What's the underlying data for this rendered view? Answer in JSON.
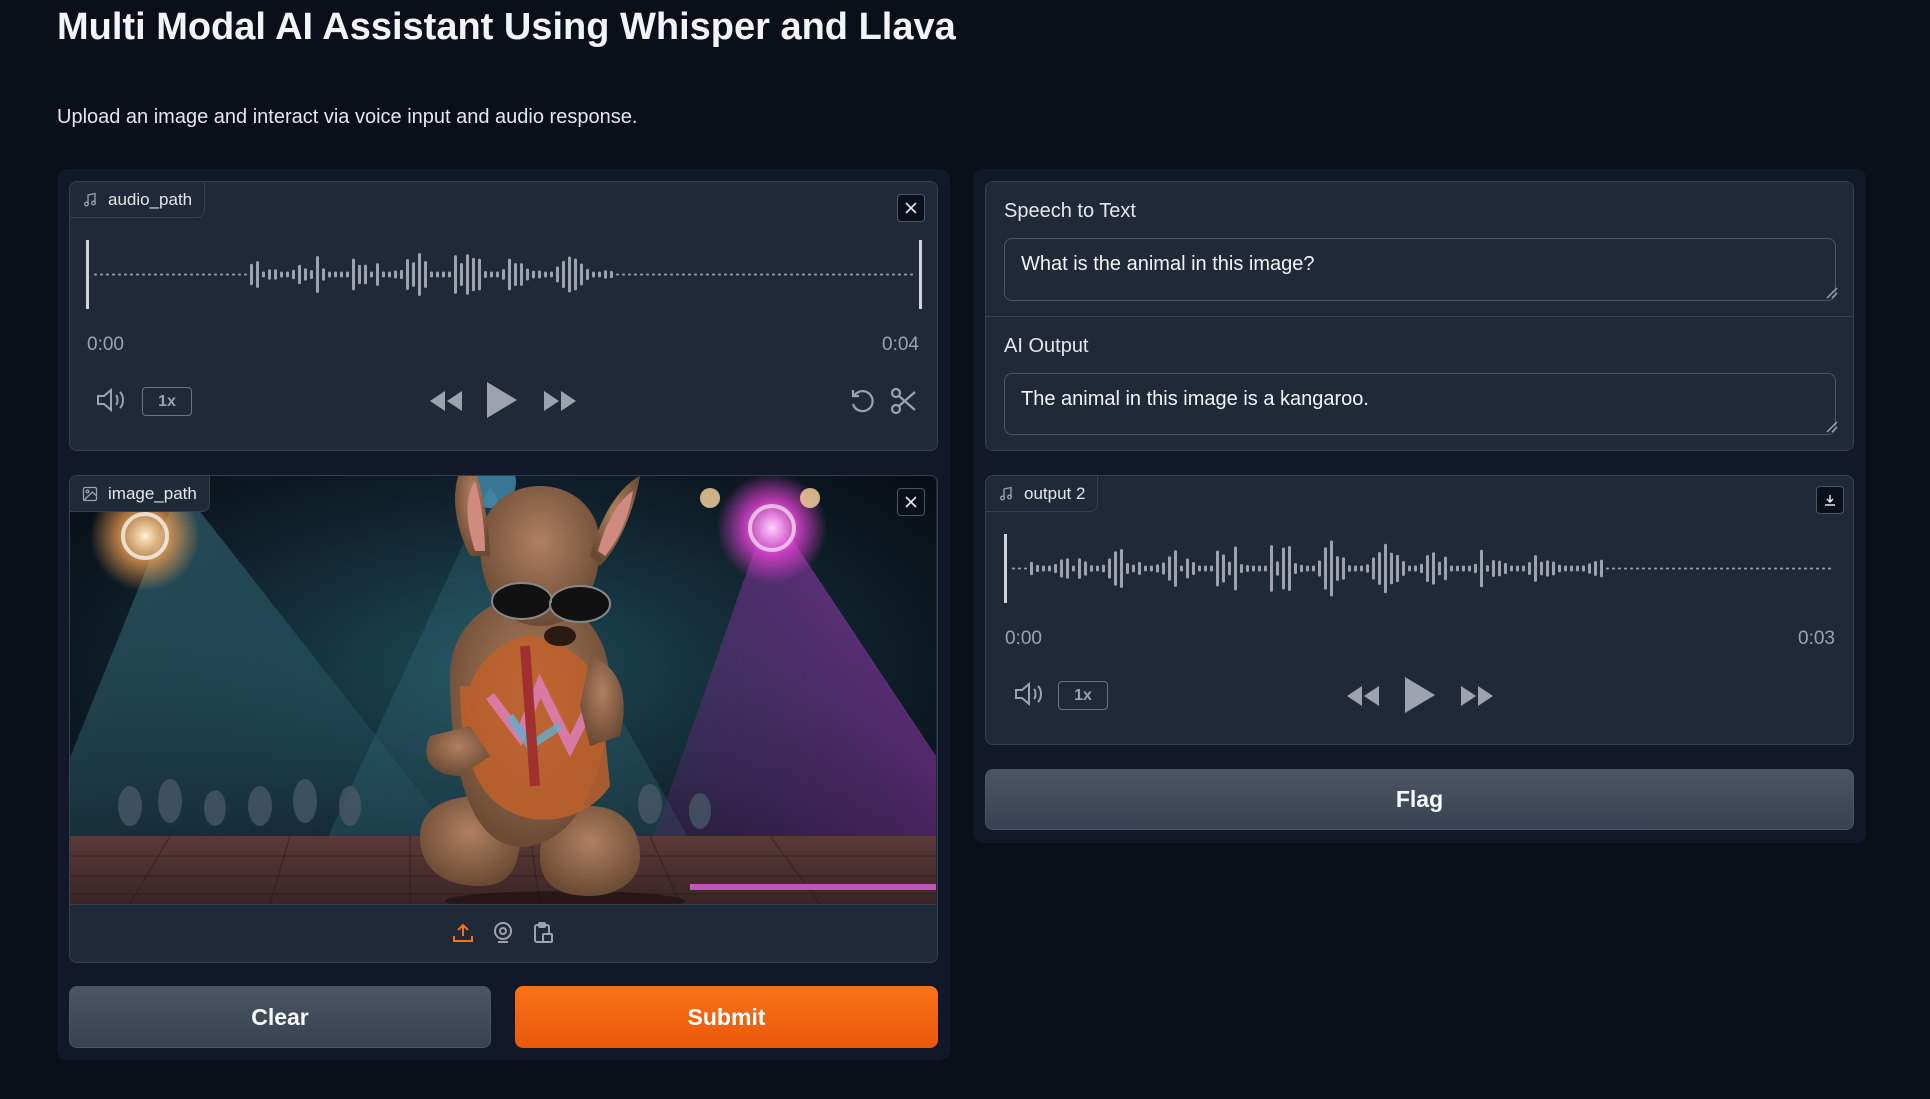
{
  "header": {
    "title": "Multi Modal AI Assistant Using Whisper and Llava",
    "description": "Upload an image and interact via voice input and audio response."
  },
  "audio_input": {
    "label": "audio_path",
    "icon": "music-note-icon",
    "time_start": "0:00",
    "time_end": "0:04",
    "playback_rate": "1x",
    "progress": 0
  },
  "image_input": {
    "label": "image_path",
    "icon": "image-icon",
    "source_icons": [
      "upload-icon",
      "webcam-icon",
      "clipboard-icon"
    ]
  },
  "buttons": {
    "clear": "Clear",
    "submit": "Submit",
    "flag": "Flag"
  },
  "outputs": {
    "speech_to_text": {
      "label": "Speech to Text",
      "value": "What is the animal in this image?"
    },
    "ai_output": {
      "label": "AI Output",
      "value": "The animal in this image is a kangaroo."
    },
    "audio_output": {
      "label": "output 2",
      "icon": "music-note-icon",
      "time_start": "0:00",
      "time_end": "0:03",
      "playback_rate": "1x",
      "progress": 0
    }
  },
  "colors": {
    "background": "#0b0f19",
    "panel": "#111827",
    "block": "#1f2937",
    "accent": "#f97316",
    "waveform": "#9ca3af"
  }
}
